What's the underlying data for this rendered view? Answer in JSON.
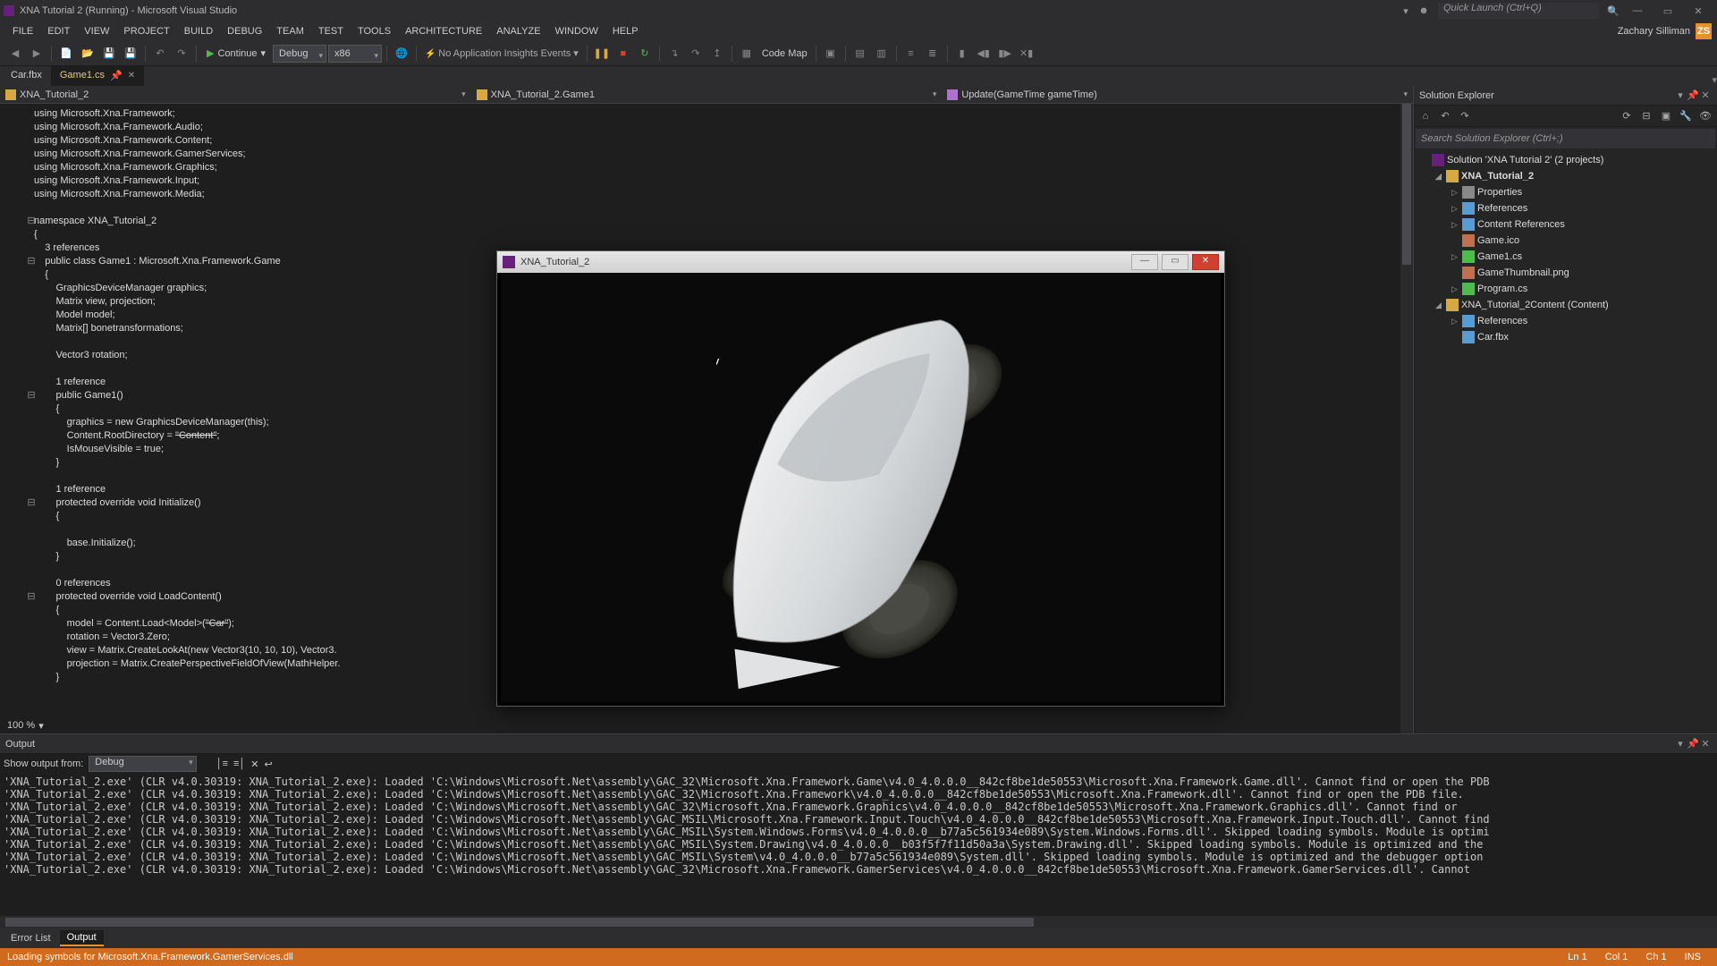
{
  "title": "XNA Tutorial 2 (Running) - Microsoft Visual Studio",
  "quicklaunch_placeholder": "Quick Launch (Ctrl+Q)",
  "menus": [
    "FILE",
    "EDIT",
    "VIEW",
    "PROJECT",
    "BUILD",
    "DEBUG",
    "TEAM",
    "TEST",
    "TOOLS",
    "ARCHITECTURE",
    "ANALYZE",
    "WINDOW",
    "HELP"
  ],
  "user_name": "Zachary Silliman",
  "user_badge": "ZS",
  "toolbar": {
    "continue": "Continue",
    "config": "Debug",
    "platform": "x86",
    "insights": "No Application Insights Events ▾",
    "codemap": "Code Map"
  },
  "filetabs": [
    {
      "label": "Car.fbx",
      "active": false
    },
    {
      "label": "Game1.cs",
      "active": true,
      "pinned": true
    }
  ],
  "navbar": {
    "left": "XNA_Tutorial_2",
    "mid": "XNA_Tutorial_2.Game1",
    "right": "Update(GameTime gameTime)"
  },
  "code_lines": [
    {
      "t": "<k>using</k> Microsoft.Xna.Framework;"
    },
    {
      "t": "<k>using</k> Microsoft.Xna.Framework.Audio;"
    },
    {
      "t": "<k>using</k> Microsoft.Xna.Framework.Content;"
    },
    {
      "t": "<k>using</k> Microsoft.Xna.Framework.GamerServices;"
    },
    {
      "t": "<k>using</k> Microsoft.Xna.Framework.Graphics;"
    },
    {
      "t": "<k>using</k> Microsoft.Xna.Framework.Input;"
    },
    {
      "t": "<k>using</k> Microsoft.Xna.Framework.Media;"
    },
    {
      "t": ""
    },
    {
      "o": "⊟",
      "t": "<k>namespace</k> XNA_Tutorial_2"
    },
    {
      "t": "{"
    },
    {
      "t": "    <ref>3 references</ref>"
    },
    {
      "o": "⊟",
      "t": "    <k>public class</k> <t>Game1</t> : Microsoft.Xna.Framework.<t>Game</t>"
    },
    {
      "t": "    {"
    },
    {
      "t": "        <t>GraphicsDeviceManager</t> graphics;"
    },
    {
      "t": "        <t>Matrix</t> view, projection;"
    },
    {
      "t": "        <t>Model</t> model;"
    },
    {
      "t": "        <t>Matrix</t>[] bonetransformations;"
    },
    {
      "t": ""
    },
    {
      "t": "        <t>Vector3</t> rotation;"
    },
    {
      "t": ""
    },
    {
      "t": "        <ref>1 reference</ref>"
    },
    {
      "o": "⊟",
      "t": "        <k>public</k> Game1()"
    },
    {
      "t": "        {"
    },
    {
      "t": "            graphics = <k>new</k> <t>GraphicsDeviceManager</t>(<k>this</k>);"
    },
    {
      "t": "            Content.RootDirectory = <s>\"Content\"</s>;"
    },
    {
      "t": "            IsMouseVisible = <k>true</k>;"
    },
    {
      "t": "        }"
    },
    {
      "t": ""
    },
    {
      "t": "        <ref>1 reference</ref>"
    },
    {
      "o": "⊟",
      "t": "        <k>protected override void</k> Initialize()"
    },
    {
      "t": "        {"
    },
    {
      "t": ""
    },
    {
      "t": "            <k>base</k>.Initialize();"
    },
    {
      "t": "        }"
    },
    {
      "t": ""
    },
    {
      "t": "        <ref>0 references</ref>"
    },
    {
      "o": "⊟",
      "t": "        <k>protected override void</k> LoadContent()"
    },
    {
      "t": "        {"
    },
    {
      "t": "            model = Content.Load&lt;<t>Model</t>&gt;(<s>\"Car\"</s>);"
    },
    {
      "t": "            rotation = <t>Vector3</t>.Zero;"
    },
    {
      "t": "            view = <t>Matrix</t>.CreateLookAt(<k>new</k> <t>Vector3</t>(<n>10</n>, <n>10</n>, <n>10</n>), <t>Vector3</t>."
    },
    {
      "t": "            projection = <t>Matrix</t>.CreatePerspectiveFieldOfView(<t>MathHelper</t>."
    },
    {
      "t": "        }"
    }
  ],
  "zoom": "100 %",
  "solution_explorer": {
    "title": "Solution Explorer",
    "search_placeholder": "Search Solution Explorer (Ctrl+;)",
    "tree": [
      {
        "d": 0,
        "tw": "",
        "ico": "sol",
        "label": "Solution 'XNA Tutorial 2' (2 projects)"
      },
      {
        "d": 1,
        "tw": "◢",
        "ico": "proj",
        "label": "XNA_Tutorial_2",
        "bold": true
      },
      {
        "d": 2,
        "tw": "▷",
        "ico": "wrench",
        "label": "Properties"
      },
      {
        "d": 2,
        "tw": "▷",
        "ico": "ref",
        "label": "References"
      },
      {
        "d": 2,
        "tw": "▷",
        "ico": "ref",
        "label": "Content References"
      },
      {
        "d": 2,
        "tw": "",
        "ico": "img",
        "label": "Game.ico"
      },
      {
        "d": 2,
        "tw": "▷",
        "ico": "cs",
        "label": "Game1.cs"
      },
      {
        "d": 2,
        "tw": "",
        "ico": "img",
        "label": "GameThumbnail.png"
      },
      {
        "d": 2,
        "tw": "▷",
        "ico": "cs",
        "label": "Program.cs"
      },
      {
        "d": 1,
        "tw": "◢",
        "ico": "proj",
        "label": "XNA_Tutorial_2Content (Content)"
      },
      {
        "d": 2,
        "tw": "▷",
        "ico": "ref",
        "label": "References"
      },
      {
        "d": 2,
        "tw": "",
        "ico": "fbx",
        "label": "Car.fbx"
      }
    ]
  },
  "output": {
    "title": "Output",
    "show_label": "Show output from:",
    "source": "Debug",
    "lines": [
      "'XNA_Tutorial_2.exe' (CLR v4.0.30319: XNA_Tutorial_2.exe): Loaded 'C:\\Windows\\Microsoft.Net\\assembly\\GAC_32\\Microsoft.Xna.Framework.Game\\v4.0_4.0.0.0__842cf8be1de50553\\Microsoft.Xna.Framework.Game.dll'. Cannot find or open the PDB",
      "'XNA_Tutorial_2.exe' (CLR v4.0.30319: XNA_Tutorial_2.exe): Loaded 'C:\\Windows\\Microsoft.Net\\assembly\\GAC_32\\Microsoft.Xna.Framework\\v4.0_4.0.0.0__842cf8be1de50553\\Microsoft.Xna.Framework.dll'. Cannot find or open the PDB file.",
      "'XNA_Tutorial_2.exe' (CLR v4.0.30319: XNA_Tutorial_2.exe): Loaded 'C:\\Windows\\Microsoft.Net\\assembly\\GAC_32\\Microsoft.Xna.Framework.Graphics\\v4.0_4.0.0.0__842cf8be1de50553\\Microsoft.Xna.Framework.Graphics.dll'. Cannot find or",
      "'XNA_Tutorial_2.exe' (CLR v4.0.30319: XNA_Tutorial_2.exe): Loaded 'C:\\Windows\\Microsoft.Net\\assembly\\GAC_MSIL\\Microsoft.Xna.Framework.Input.Touch\\v4.0_4.0.0.0__842cf8be1de50553\\Microsoft.Xna.Framework.Input.Touch.dll'. Cannot find",
      "'XNA_Tutorial_2.exe' (CLR v4.0.30319: XNA_Tutorial_2.exe): Loaded 'C:\\Windows\\Microsoft.Net\\assembly\\GAC_MSIL\\System.Windows.Forms\\v4.0_4.0.0.0__b77a5c561934e089\\System.Windows.Forms.dll'. Skipped loading symbols. Module is optimi",
      "'XNA_Tutorial_2.exe' (CLR v4.0.30319: XNA_Tutorial_2.exe): Loaded 'C:\\Windows\\Microsoft.Net\\assembly\\GAC_MSIL\\System.Drawing\\v4.0_4.0.0.0__b03f5f7f11d50a3a\\System.Drawing.dll'. Skipped loading symbols. Module is optimized and the",
      "'XNA_Tutorial_2.exe' (CLR v4.0.30319: XNA_Tutorial_2.exe): Loaded 'C:\\Windows\\Microsoft.Net\\assembly\\GAC_MSIL\\System\\v4.0_4.0.0.0__b77a5c561934e089\\System.dll'. Skipped loading symbols. Module is optimized and the debugger option",
      "'XNA_Tutorial_2.exe' (CLR v4.0.30319: XNA_Tutorial_2.exe): Loaded 'C:\\Windows\\Microsoft.Net\\assembly\\GAC_32\\Microsoft.Xna.Framework.GamerServices\\v4.0_4.0.0.0__842cf8be1de50553\\Microsoft.Xna.Framework.GamerServices.dll'. Cannot"
    ]
  },
  "bottom_tabs": [
    "Error List",
    "Output"
  ],
  "status": {
    "msg": "Loading symbols for Microsoft.Xna.Framework.GamerServices.dll",
    "ln": "Ln 1",
    "col": "Col 1",
    "ch": "Ch 1",
    "ins": "INS"
  },
  "gamewin_title": "XNA_Tutorial_2"
}
